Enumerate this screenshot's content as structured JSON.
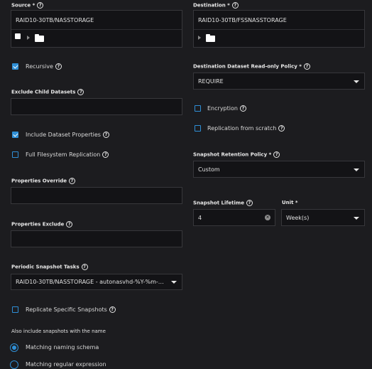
{
  "source": {
    "label": "Source *",
    "value": "RAID10-30TB/NASSTORAGE"
  },
  "destination": {
    "label": "Destination *",
    "value": "RAID10-30TB/FSSNASSTORAGE"
  },
  "recursive": {
    "label": "Recursive",
    "checked": true
  },
  "exclude_child": {
    "label": "Exclude Child Datasets",
    "value": ""
  },
  "include_props": {
    "label": "Include Dataset Properties",
    "checked": true
  },
  "full_fs": {
    "label": "Full Filesystem Replication",
    "checked": false
  },
  "props_override": {
    "label": "Properties Override",
    "value": ""
  },
  "props_exclude": {
    "label": "Properties Exclude",
    "value": ""
  },
  "periodic": {
    "label": "Periodic Snapshot Tasks",
    "value": "RAID10-30TB/NASSTORAGE - autonasvhd-%Y-%m-%d_%..."
  },
  "replicate_specific": {
    "label": "Replicate Specific Snapshots",
    "checked": false
  },
  "also_include": {
    "label": "Also include snapshots with the name"
  },
  "naming": {
    "option1": "Matching naming schema",
    "option2": "Matching regular expression",
    "selected": "option1"
  },
  "dest_ro_policy": {
    "label": "Destination Dataset Read-only Policy *",
    "value": "REQUIRE"
  },
  "encryption": {
    "label": "Encryption",
    "checked": false
  },
  "from_scratch": {
    "label": "Replication from scratch",
    "checked": false
  },
  "retention": {
    "label": "Snapshot Retention Policy *",
    "value": "Custom"
  },
  "lifetime": {
    "label": "Snapshot Lifetime",
    "value": "4"
  },
  "unit": {
    "label": "Unit *",
    "value": "Week(s)"
  },
  "icons": {
    "help": "?",
    "clear": "×"
  },
  "colors": {
    "accent": "#2f8fd6",
    "background": "#1c1c1f",
    "field": "#131316"
  }
}
